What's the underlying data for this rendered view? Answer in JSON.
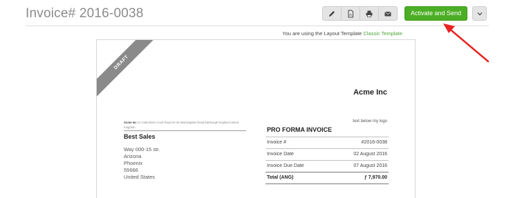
{
  "header": {
    "title": "Invoice# 2016-0038",
    "toolbar": [
      {
        "icon": "pencil-icon"
      },
      {
        "icon": "pdf-file-icon"
      },
      {
        "icon": "printer-icon"
      },
      {
        "icon": "envelope-icon"
      }
    ],
    "activate_label": "Activate and Send",
    "dropdown_icon": "chevron-down-icon",
    "accent_color": "#4cae24"
  },
  "layout_note": {
    "prefix": "You are using the Layout Template ",
    "link": "Classic Template"
  },
  "annotation": {
    "arrow_color": "#e8231f"
  },
  "invoice": {
    "ribbon": "DRAFT",
    "company": "Acme Inc",
    "logo_text": "text below my logo",
    "sender": {
      "name": "Acme Inc",
      "address": "14 Cottenham Court Road #4-46 Warningside Road Edinburgh England United Kingdom"
    },
    "client": {
      "name": "Best Sales",
      "lines": [
        "Way 000-15 str.",
        "Arizona",
        "Phoenix",
        "55666",
        "United States"
      ]
    },
    "doc_title": "PRO FORMA INVOICE",
    "meta": [
      {
        "label": "Invoice #",
        "value": "#2016-0038"
      },
      {
        "label": "Invoice Date",
        "value": "02 August 2016"
      },
      {
        "label": "Invoice Due Date",
        "value": "07 August 2016"
      }
    ],
    "total": {
      "label": "Total (ANG)",
      "value": "ƒ 7,970.00"
    }
  }
}
